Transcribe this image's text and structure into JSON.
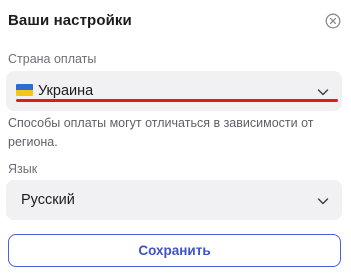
{
  "dialog": {
    "title": "Ваши настройки",
    "close_icon": "close-circle-icon"
  },
  "country": {
    "label": "Страна оплаты",
    "value": "Украина",
    "flag_icon": "ukraine-flag-icon",
    "chevron_icon": "chevron-down-icon"
  },
  "note": "Способы оплаты могут отличаться в зависимости от региона.",
  "language": {
    "label": "Язык",
    "value": "Русский",
    "chevron_icon": "chevron-down-icon"
  },
  "save_label": "Сохранить",
  "colors": {
    "accent": "#4b5fd6",
    "highlight": "#e01b1b",
    "select_bg": "#f1f1f3"
  }
}
